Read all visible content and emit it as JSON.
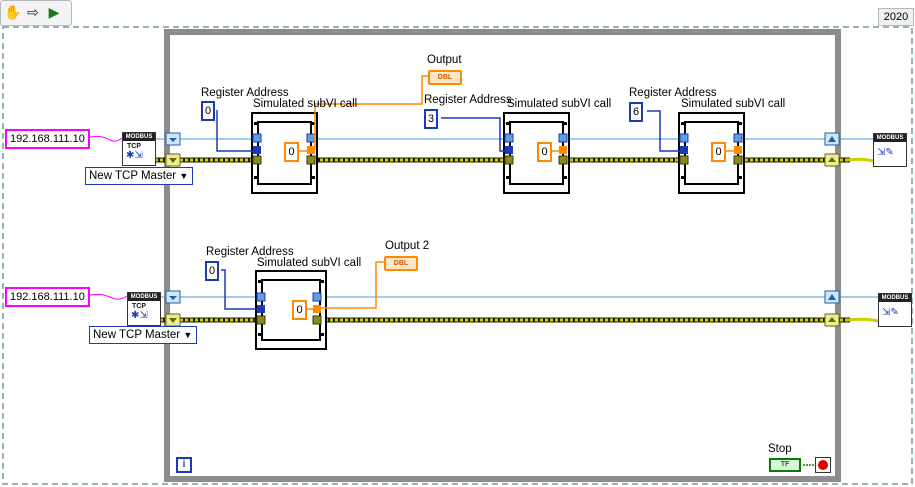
{
  "version": "2020",
  "toolbar": {
    "run_icon": "hand-icon",
    "step_icon": "arrow-icon",
    "run_arrow_icon": "run-arrow-icon"
  },
  "session1": {
    "ip": "192.168.111.10",
    "mode": "New TCP Master",
    "output_label": "Output",
    "output_type": "DBL",
    "subvis": [
      {
        "addr_label": "Register Address",
        "addr_value": "0",
        "call_label": "Simulated subVI call",
        "const_value": "0"
      },
      {
        "addr_label": "Register Address",
        "addr_value": "3",
        "call_label": "Simulated subVI call",
        "const_value": "0"
      },
      {
        "addr_label": "Register Address",
        "addr_value": "6",
        "call_label": "Simulated subVI call",
        "const_value": "0"
      }
    ]
  },
  "session2": {
    "ip": "192.168.111.10",
    "mode": "New TCP Master",
    "output_label": "Output 2",
    "output_type": "DBL",
    "subvis": [
      {
        "addr_label": "Register Address",
        "addr_value": "0",
        "call_label": "Simulated subVI call",
        "const_value": "0"
      }
    ]
  },
  "modbus": {
    "label": "MODBUS",
    "tcp_text": "TCP"
  },
  "stop": {
    "label": "Stop",
    "bool_text": "TF"
  },
  "loop": {
    "info_text": "i"
  },
  "colors": {
    "cluster_wire": "#ff00ff",
    "i32_wire": "#1a3ab8",
    "dbl_wire": "#ff8a00",
    "error_wire": "#cfcf00",
    "refnum_wire": "#3aa0d8",
    "loop_border": "#8c8c8c"
  }
}
